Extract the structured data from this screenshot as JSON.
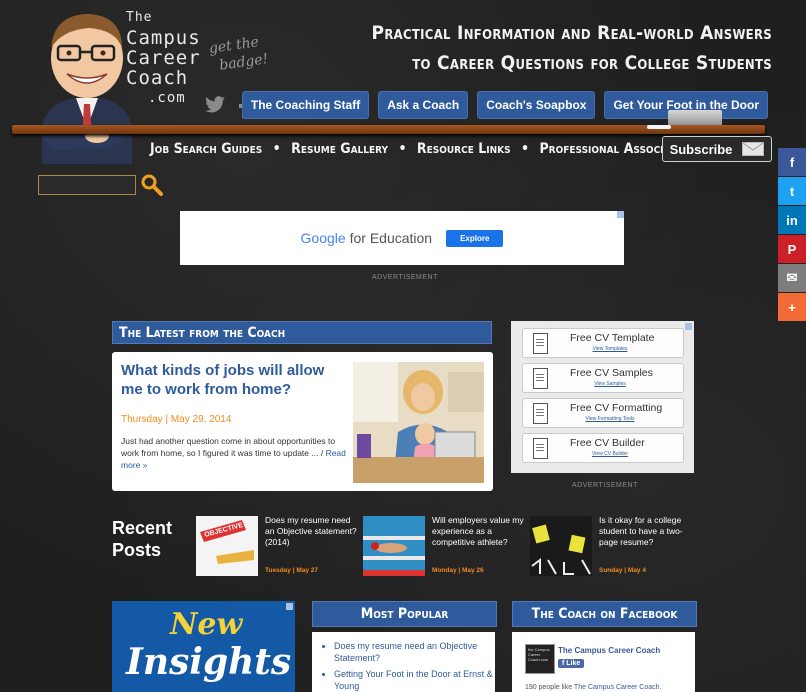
{
  "logo": {
    "line1": "The",
    "line2": "Campus",
    "line3": "Career",
    "line4": "Coach",
    "line5": ".com"
  },
  "badge_text": {
    "line1": "get the",
    "line2": "badge!"
  },
  "tagline": {
    "line1": "Practical Information and Real-world Answers",
    "line2": "to Career Questions for College Students"
  },
  "nav": [
    "The Coaching Staff",
    "Ask a Coach",
    "Coach's Soapbox",
    "Get Your Foot in the Door"
  ],
  "subnav": [
    "Job Search Guides",
    "•",
    "Resume Gallery",
    "•",
    "Resource Links",
    "•",
    "Professional Associations"
  ],
  "subscribe_label": "Subscribe",
  "search": {
    "placeholder": ""
  },
  "top_ad": {
    "brand_google": "Google",
    "brand_rest": "for Education",
    "cta": "Explore",
    "label": "ADVERTISEMENT"
  },
  "latest": {
    "header": "The Latest from the Coach",
    "title": "What kinds of jobs will allow me to work from home?",
    "date": "Thursday | May 29, 2014",
    "excerpt": "Just had another question come in about opportunities to work from home, so I figured it was time to update ... / ",
    "more": "Read more »"
  },
  "right_ad": {
    "items": [
      {
        "title": "Free CV Template",
        "sub": "View Templates"
      },
      {
        "title": "Free CV Samples",
        "sub": "View Samples"
      },
      {
        "title": "Free CV Formatting",
        "sub": "View Formatting Tools"
      },
      {
        "title": "Free CV Builder",
        "sub": "View CV Builder"
      }
    ],
    "label": "ADVERTISEMENT"
  },
  "recent": {
    "title_l1": "Recent",
    "title_l2": "Posts",
    "posts": [
      {
        "title": "Does my resume need an Objective statement? (2014)",
        "date": "Tuesday | May 27"
      },
      {
        "title": "Will employers value my experience as a competitive athlete?",
        "date": "Monday | May 26"
      },
      {
        "title": "Is it okay for a college student to have a two-page resume?",
        "date": "Sunday | May 4"
      }
    ],
    "thumb_text": "OBJECTIVE"
  },
  "bottom_ad": {
    "line1": "New",
    "line2": "Insights"
  },
  "popular": {
    "header": "Most Popular",
    "items": [
      "Does my resume need an Objective Statement?",
      "Getting Your Foot in the Door at Ernst & Young"
    ]
  },
  "facebook": {
    "header": "The Coach on Facebook",
    "page": "The Campus Career Coach",
    "like": "Like",
    "likes_prefix": "190 people like ",
    "likes_link": "The Campus Career Coach.",
    "thumb_text": "the Campus Career Coach.com"
  },
  "share": {
    "facebook": "f",
    "twitter": "t",
    "linkedin": "in",
    "pinterest": "P",
    "email": "✉",
    "more": "+"
  },
  "colors": {
    "accent": "#2f5b9c",
    "orange": "#f08c1e",
    "background": "#1f1f1f"
  }
}
